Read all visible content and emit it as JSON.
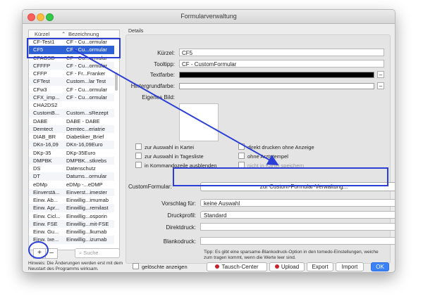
{
  "window": {
    "title": "Formularverwaltung"
  },
  "list": {
    "col_kuerzel": "Kürzel",
    "col_bezeichnung": "Bezeichnung",
    "rows": [
      {
        "k": "CF-Test1",
        "b": "CF - Cu...ormular"
      },
      {
        "k": "CF5",
        "b": "CF - Cu...ormular"
      },
      {
        "k": "CFAGSD",
        "b": "CF - Cu...ormular"
      },
      {
        "k": "CFFFP",
        "b": "CF - Cu...ormular"
      },
      {
        "k": "CFFP",
        "b": "CF - Fr...Franker"
      },
      {
        "k": "CFTest",
        "b": "Custom...lar Test"
      },
      {
        "k": "CFw3",
        "b": "CF - Cu...ormular"
      },
      {
        "k": "CFX_imp...",
        "b": "CF - Cu...ormular"
      },
      {
        "k": "CHA2DS2",
        "b": ""
      },
      {
        "k": "CustomB...",
        "b": "Custom...sRezept"
      },
      {
        "k": "DABE",
        "b": "DABE - DABE"
      },
      {
        "k": "Demtect",
        "b": "Demtec...eriatrie"
      },
      {
        "k": "DIAB_BR",
        "b": "Diabetiker_Brief"
      },
      {
        "k": "DKn-16,09",
        "b": "DKn-16,09Euro"
      },
      {
        "k": "DKp-35",
        "b": "DKp-35Euro"
      },
      {
        "k": "DMPBK",
        "b": "DMPBK...stkrebs"
      },
      {
        "k": "DS",
        "b": "Datenschutz"
      },
      {
        "k": "DT",
        "b": "Datums...ormular"
      },
      {
        "k": "eDMp",
        "b": "eDMp -...eDMP"
      },
      {
        "k": "Einverstä...",
        "b": "Einverst...imester"
      },
      {
        "k": "Einw. Ab...",
        "b": "Einwillig...imumab"
      },
      {
        "k": "Einw. Apr...",
        "b": "Einwillig...remilast"
      },
      {
        "k": "Einw. Cicl...",
        "b": "Einwillig...osporin"
      },
      {
        "k": "Einw. FSE",
        "b": "Einwillig...mit-FSE"
      },
      {
        "k": "Einw. Gu...",
        "b": "Einwillig...lkumab"
      },
      {
        "k": "Einw. Ixe...",
        "b": "Einwillig...izumab"
      }
    ],
    "selected_index": 1,
    "add": "+",
    "remove": "–",
    "search_placeholder": "Suche"
  },
  "hint": "Hinweis: Die Änderungen werden erst mit dem Neustart des Programms wirksam.",
  "details": {
    "label": "Details",
    "kuerzel_label": "Kürzel:",
    "kuerzel_value": "CF5",
    "tooltip_label": "Tooltipp:",
    "tooltip_value": "CF - CustomFormular",
    "textfarbe_label": "Textfarbe:",
    "textfarbe_color": "#000000",
    "hintergrund_label": "Hintergrundfarbe:",
    "hintergrund_color": "#ffffff",
    "bild_label": "Eigenes Bild:",
    "cb_kartei": "zur Auswahl in Kartei",
    "cb_tagesliste": "zur Auswahl in Tagesliste",
    "cb_kommando": "in Kommandozeile ausblenden",
    "cb_direkt": "direkt drucken ohne Anzeige",
    "cb_arztstempel": "ohne Arztstempel",
    "cb_kartei_speichern": "nicht in Kartei speichern",
    "customformular_label": "CustomFormular:",
    "customformular_button": "zur Custom-Formular-Verwaltung...",
    "vorschlag_label": "Vorschlag für:",
    "vorschlag_value": "keine Auswahl",
    "druckprofil_label": "Druckprofil:",
    "druckprofil_value": "Standard",
    "direktdruck_label": "Direktdruck:",
    "blankodruck_label": "Blankodruck:",
    "tipp": "Tipp: Es gibt eine sparsame-Blankodruck-Option in den tomedo-Einstellungen, weiche zum tragen kommt, wenn die Werte leer sind."
  },
  "bottom": {
    "geloeschte": "gelöschte anzeigen",
    "tausch": "Tausch-Center",
    "upload": "Upload",
    "export": "Export",
    "import": "Import",
    "ok": "OK"
  },
  "accent_color": "#2b3fd6"
}
